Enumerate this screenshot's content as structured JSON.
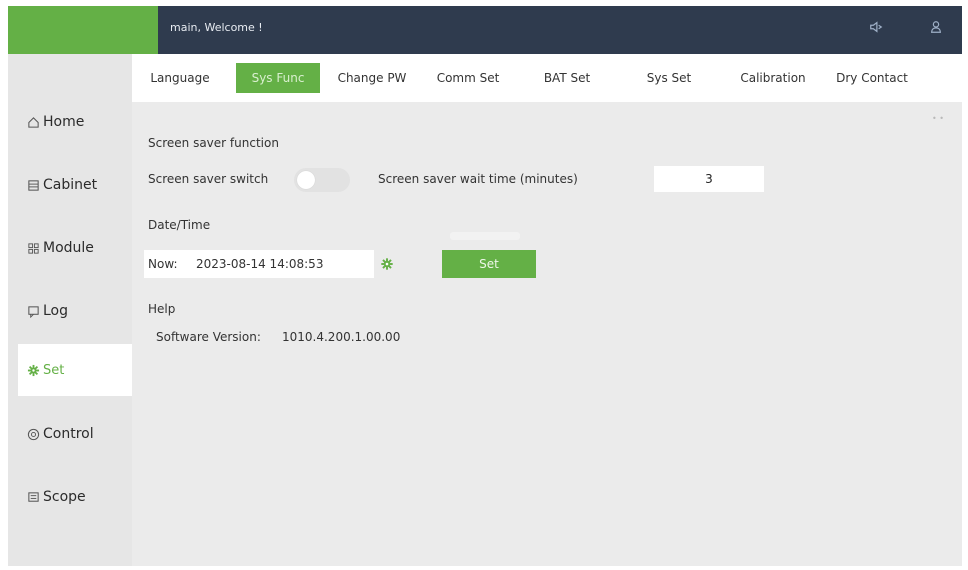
{
  "header": {
    "welcome_text": "main, Welcome !",
    "icons": [
      "sound-icon",
      "user-icon"
    ]
  },
  "sidebar": {
    "items": [
      {
        "label": "Home",
        "icon": "home-icon"
      },
      {
        "label": "Cabinet",
        "icon": "cabinet-icon"
      },
      {
        "label": "Module",
        "icon": "module-icon"
      },
      {
        "label": "Log",
        "icon": "log-icon"
      },
      {
        "label": "Set",
        "icon": "gear-icon",
        "active": true
      },
      {
        "label": "Control",
        "icon": "control-icon"
      },
      {
        "label": "Scope",
        "icon": "scope-icon"
      }
    ]
  },
  "tabs": [
    {
      "label": "Language"
    },
    {
      "label": "Sys Func",
      "active": true
    },
    {
      "label": "Change PW"
    },
    {
      "label": "Comm Set"
    },
    {
      "label": "BAT Set"
    },
    {
      "label": "Sys Set"
    },
    {
      "label": "Calibration"
    },
    {
      "label": "Dry Contact"
    }
  ],
  "screen_saver": {
    "section_title": "Screen saver function",
    "switch_label": "Screen saver switch",
    "switch_on": false,
    "wait_label": "Screen saver wait time (minutes)",
    "wait_value": "3"
  },
  "datetime": {
    "section_title": "Date/Time",
    "now_label": "Now:",
    "now_value": "2023-08-14 14:08:53",
    "set_label": "Set"
  },
  "help": {
    "section_title": "Help",
    "version_label": "Software Version:",
    "version_value": "1010.4.200.1.00.00"
  },
  "colors": {
    "accent": "#64b046",
    "topbar": "#2f3b4e",
    "background": "#e9e9e9"
  }
}
